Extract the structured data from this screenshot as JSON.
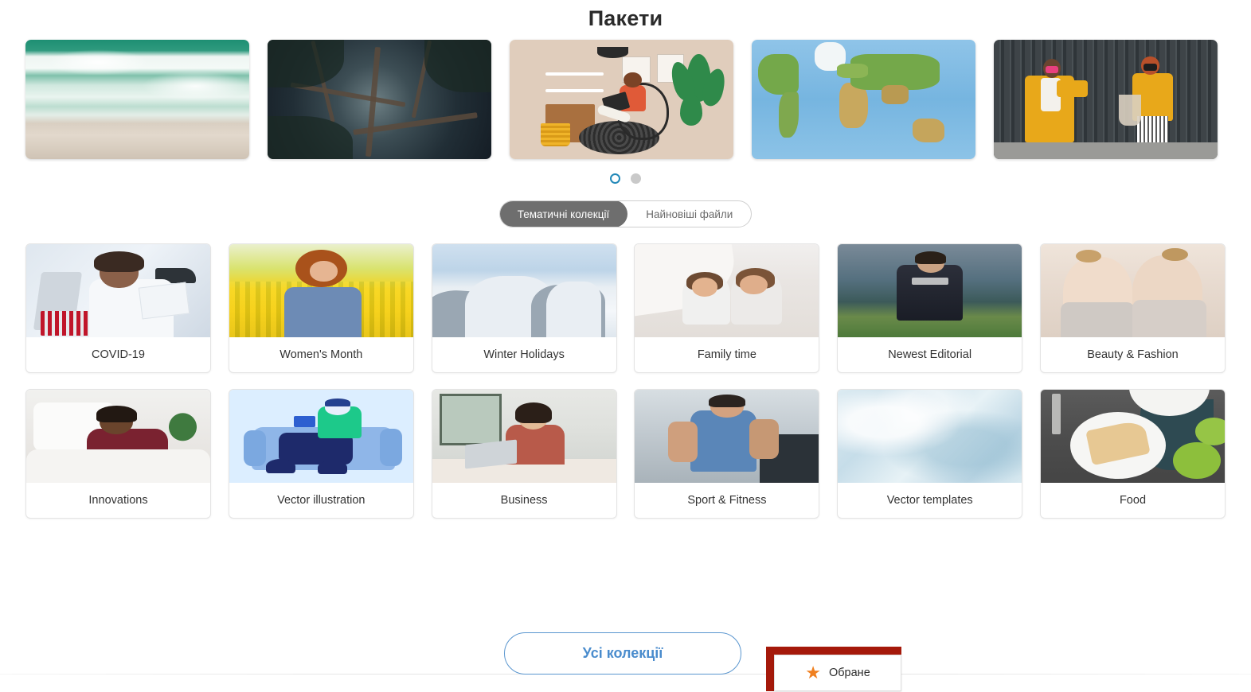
{
  "header": {
    "title": "Пакети"
  },
  "carousel": {
    "slides": [
      {
        "alt": "aerial-beach-waves"
      },
      {
        "alt": "forest-canopy-trees"
      },
      {
        "alt": "illustration-woman-with-laptop"
      },
      {
        "alt": "physical-world-map"
      },
      {
        "alt": "two-women-yellow-outfits-masks"
      }
    ],
    "dots": [
      {
        "state": "active"
      },
      {
        "state": "idle"
      }
    ]
  },
  "tabs": [
    {
      "label": "Тематичні колекції",
      "active": true
    },
    {
      "label": "Найновіші файли",
      "active": false
    }
  ],
  "collections": [
    {
      "label": "COVID-19",
      "art": "th-lab"
    },
    {
      "label": "Women's Month",
      "art": "th-tulip"
    },
    {
      "label": "Winter Holidays",
      "art": "th-winter"
    },
    {
      "label": "Family time",
      "art": "th-family"
    },
    {
      "label": "Newest Editorial",
      "art": "th-editorial"
    },
    {
      "label": "Beauty & Fashion",
      "art": "th-beauty"
    },
    {
      "label": "Innovations",
      "art": "th-innov"
    },
    {
      "label": "Vector illustration",
      "art": "th-vector"
    },
    {
      "label": "Business",
      "art": "th-business"
    },
    {
      "label": "Sport & Fitness",
      "art": "th-sport"
    },
    {
      "label": "Vector templates",
      "art": "th-vtemp"
    },
    {
      "label": "Food",
      "art": "th-food"
    }
  ],
  "footer": {
    "all_collections_label": "Усі колекції",
    "favourites_label": "Обране",
    "favourites_icon": "star-icon"
  },
  "colors": {
    "accent_blue": "#4a8ccd",
    "tab_active_bg": "#6e6e6e",
    "dot_active": "#2288b8",
    "dot_idle": "#c9c9c9",
    "star_orange": "#f08020",
    "highlight_red": "#a5190a",
    "title_text": "#2b2b2b"
  }
}
